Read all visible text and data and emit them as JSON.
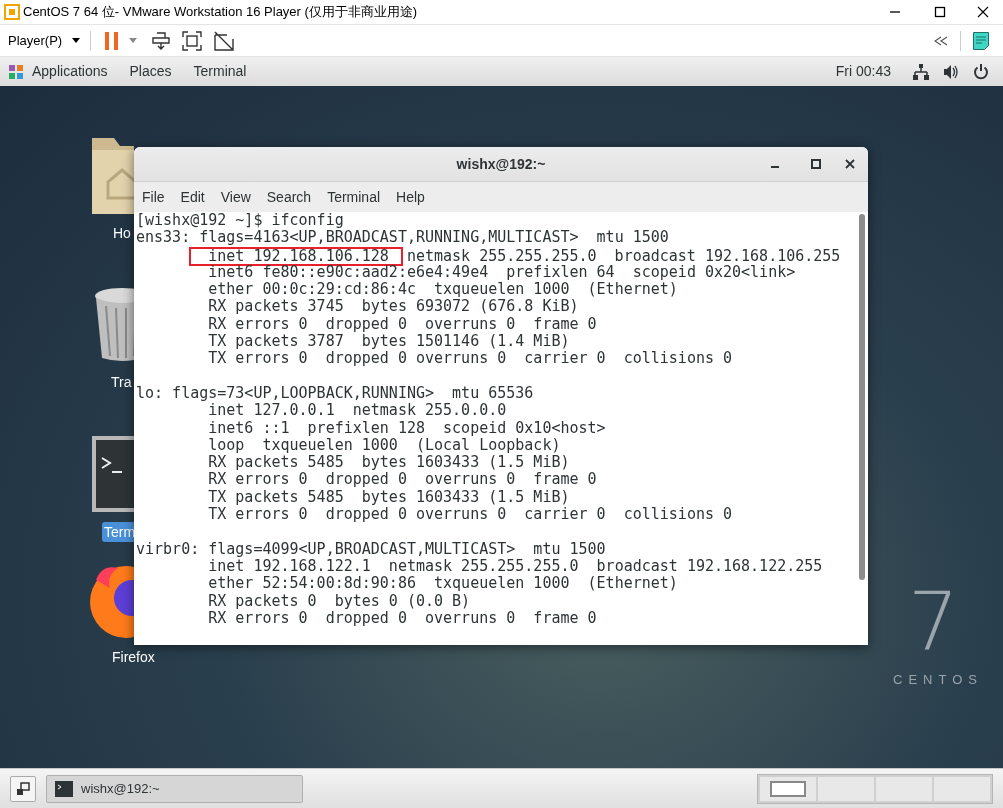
{
  "vm_window": {
    "title": "CentOS 7 64 位- VMware Workstation 16 Player (仅用于非商业用途)",
    "player_menu": "Player(P)"
  },
  "top_bar": {
    "menus": [
      "Applications",
      "Places",
      "Terminal"
    ],
    "clock": "Fri 00:43"
  },
  "desktop_icons": [
    {
      "kind": "folder",
      "label": "Ho",
      "selected": false
    },
    {
      "kind": "trash",
      "label": "Tra",
      "selected": false
    },
    {
      "kind": "terminal",
      "label": "Term",
      "selected": true
    },
    {
      "kind": "firefox",
      "label": "Firefox",
      "selected": false
    }
  ],
  "terminal": {
    "title": "wishx@192:~",
    "menu": [
      "File",
      "Edit",
      "View",
      "Search",
      "Terminal",
      "Help"
    ],
    "blocks": [
      [
        "[wishx@192 ~]$ ifconfig",
        "ens33: flags=4163<UP,BROADCAST,RUNNING,MULTICAST>  mtu 1500",
        {
          "kind": "highlight",
          "highlighted": "inet 192.168.106.128",
          "rest": "netmask 255.255.255.0  broadcast 192.168.106.255"
        },
        "        inet6 fe80::e90c:aad2:e6e4:49e4  prefixlen 64  scopeid 0x20<link>",
        "        ether 00:0c:29:cd:86:4c  txqueuelen 1000  (Ethernet)",
        "        RX packets 3745  bytes 693072 (676.8 KiB)",
        "        RX errors 0  dropped 0  overruns 0  frame 0",
        "        TX packets 3787  bytes 1501146 (1.4 MiB)",
        "        TX errors 0  dropped 0 overruns 0  carrier 0  collisions 0"
      ],
      [
        "lo: flags=73<UP,LOOPBACK,RUNNING>  mtu 65536",
        "        inet 127.0.0.1  netmask 255.0.0.0",
        "        inet6 ::1  prefixlen 128  scopeid 0x10<host>",
        "        loop  txqueuelen 1000  (Local Loopback)",
        "        RX packets 5485  bytes 1603433 (1.5 MiB)",
        "        RX errors 0  dropped 0  overruns 0  frame 0",
        "        TX packets 5485  bytes 1603433 (1.5 MiB)",
        "        TX errors 0  dropped 0 overruns 0  carrier 0  collisions 0"
      ],
      [
        "virbr0: flags=4099<UP,BROADCAST,MULTICAST>  mtu 1500",
        "        inet 192.168.122.1  netmask 255.255.255.0  broadcast 192.168.122.255",
        "        ether 52:54:00:8d:90:86  txqueuelen 1000  (Ethernet)",
        "        RX packets 0  bytes 0 (0.0 B)",
        "        RX errors 0  dropped 0  overruns 0  frame 0"
      ]
    ]
  },
  "logo": {
    "number": "7",
    "name": "CENTOS"
  },
  "taskbar": {
    "windows": [
      {
        "label": "wishx@192:~"
      }
    ]
  }
}
